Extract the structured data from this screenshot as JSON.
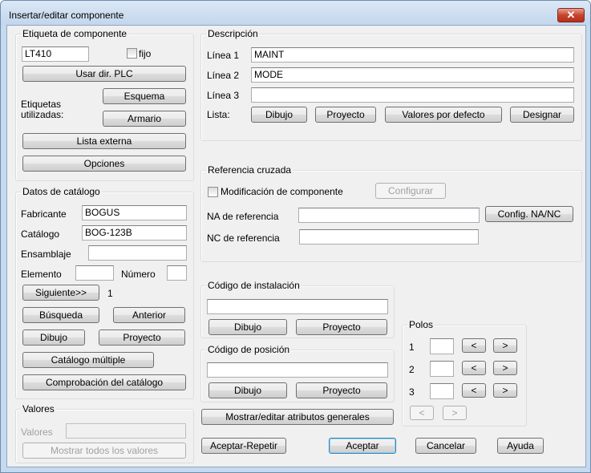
{
  "window": {
    "title": "Insertar/editar componente",
    "close_glyph": "✕"
  },
  "component_tag": {
    "group_title": "Etiqueta de componente",
    "tag_value": "LT410",
    "fixed_label": "fijo",
    "plc_button": "Usar dir. PLC",
    "tags_used_label_line1": "Etiquetas",
    "tags_used_label_line2": "utilizadas:",
    "schematic_button": "Esquema",
    "panel_button": "Armario",
    "external_list_button": "Lista externa",
    "options_button": "Opciones"
  },
  "description": {
    "group_title": "Descripción",
    "line1_label": "Línea 1",
    "line1_value": "MAINT",
    "line2_label": "Línea 2",
    "line2_value": "MODE",
    "line3_label": "Línea 3",
    "line3_value": "",
    "list_label": "Lista:",
    "drawing_button": "Dibujo",
    "project_button": "Proyecto",
    "defaults_button": "Valores por defecto",
    "pick_button": "Designar"
  },
  "catalog": {
    "group_title": "Datos de catálogo",
    "manufacturer_label": "Fabricante",
    "manufacturer_value": "BOGUS",
    "catalog_label": "Catálogo",
    "catalog_value": "BOG-123B",
    "assembly_label": "Ensamblaje",
    "assembly_value": "",
    "item_label": "Elemento",
    "item_value": "",
    "count_label": "Número",
    "count_value": "",
    "next_button": "Siguiente>>",
    "next_count": "1",
    "lookup_button": "Búsqueda",
    "previous_button": "Anterior",
    "drawing_button": "Dibujo",
    "project_button": "Proyecto",
    "multiple_catalog_button": "Catálogo múltiple",
    "catalog_check_button": "Comprobación del catálogo"
  },
  "ratings": {
    "group_title": "Valores",
    "values_label": "Valores",
    "show_all_button": "Mostrar todos los valores"
  },
  "cross_reference": {
    "group_title": "Referencia cruzada",
    "override_label": "Modificación de componente",
    "setup_button": "Configurar",
    "no_label": "NA de referencia",
    "no_value": "",
    "nc_label": "NC de referencia",
    "nc_value": "",
    "no_nc_setup_button": "Config. NA/NC"
  },
  "installation": {
    "group_title": "Código de instalación",
    "value": "",
    "drawing_button": "Dibujo",
    "project_button": "Proyecto"
  },
  "location": {
    "group_title": "Código de posición",
    "value": "",
    "drawing_button": "Dibujo",
    "project_button": "Proyecto"
  },
  "pins": {
    "group_title": "Polos",
    "rows": [
      {
        "label": "1",
        "value": "",
        "prev": "<",
        "next": ">"
      },
      {
        "label": "2",
        "value": "",
        "prev": "<",
        "next": ">"
      },
      {
        "label": "3",
        "value": "",
        "prev": "<",
        "next": ">"
      }
    ],
    "prev_all": "<",
    "next_all": ">"
  },
  "show_edit_attributes_button": "Mostrar/editar atributos generales",
  "footer": {
    "ok_repeat_button": "Aceptar-Repetir",
    "ok_button": "Aceptar",
    "cancel_button": "Cancelar",
    "help_button": "Ayuda"
  }
}
